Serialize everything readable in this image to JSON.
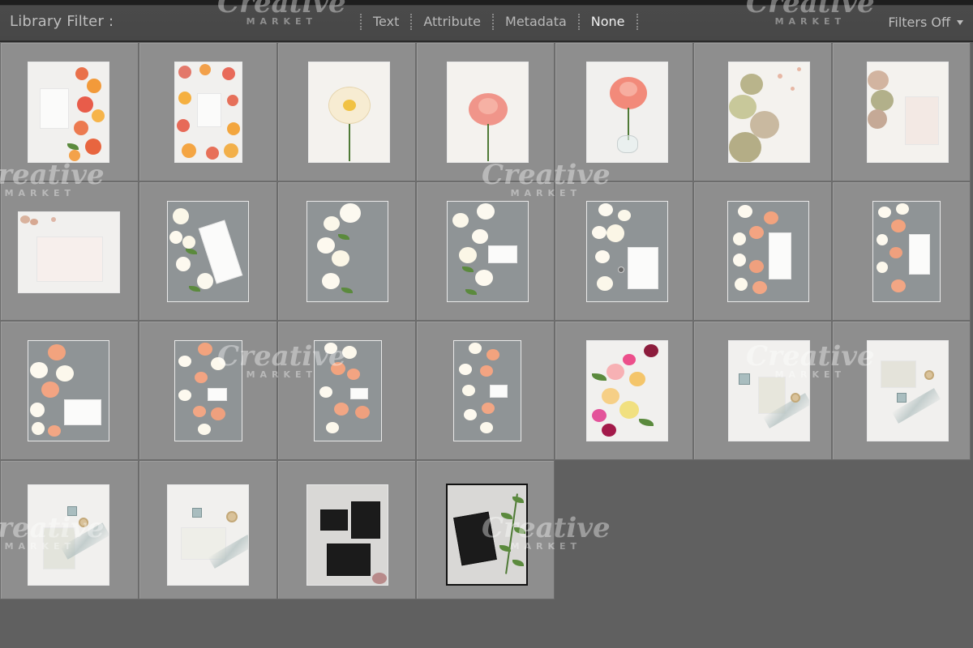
{
  "filter_bar": {
    "title": "Library Filter :",
    "modes": [
      {
        "label": "Text",
        "active": false
      },
      {
        "label": "Attribute",
        "active": false
      },
      {
        "label": "Metadata",
        "active": false
      },
      {
        "label": "None",
        "active": true
      }
    ],
    "preset": "Filters Off"
  },
  "watermark": {
    "brand": "Creative",
    "sub": "MARKET"
  },
  "colors": {
    "bar_bg": "#474747",
    "cell_bg": "#8e8e8e",
    "empty_bg": "#606060",
    "active_mode": "#f0f0f0"
  },
  "grid": {
    "columns": 7,
    "rows": 4,
    "photo_count": 25,
    "photos": [
      {
        "kind": "orange-roses-flatlay"
      },
      {
        "kind": "orange-roses-frame"
      },
      {
        "kind": "cream-peony"
      },
      {
        "kind": "pink-peony"
      },
      {
        "kind": "peony-vase"
      },
      {
        "kind": "green-hydrangea"
      },
      {
        "kind": "hydrangea-card"
      },
      {
        "kind": "envelope-landscape"
      },
      {
        "kind": "white-roses-card"
      },
      {
        "kind": "white-roses-column"
      },
      {
        "kind": "white-roses-small-card"
      },
      {
        "kind": "white-roses-card-ring"
      },
      {
        "kind": "peach-roses-card"
      },
      {
        "kind": "peach-roses-column"
      },
      {
        "kind": "peach-white-roses-card"
      },
      {
        "kind": "peach-roses-small-card"
      },
      {
        "kind": "peach-roses-notecard"
      },
      {
        "kind": "peach-roses-column-2"
      },
      {
        "kind": "colorful-bouquet"
      },
      {
        "kind": "ribbon-card"
      },
      {
        "kind": "ribbon-card-2"
      },
      {
        "kind": "ribbon-card-3"
      },
      {
        "kind": "ribbon-envelope"
      },
      {
        "kind": "black-cards"
      },
      {
        "kind": "black-card-greenery",
        "selected": true
      }
    ]
  }
}
